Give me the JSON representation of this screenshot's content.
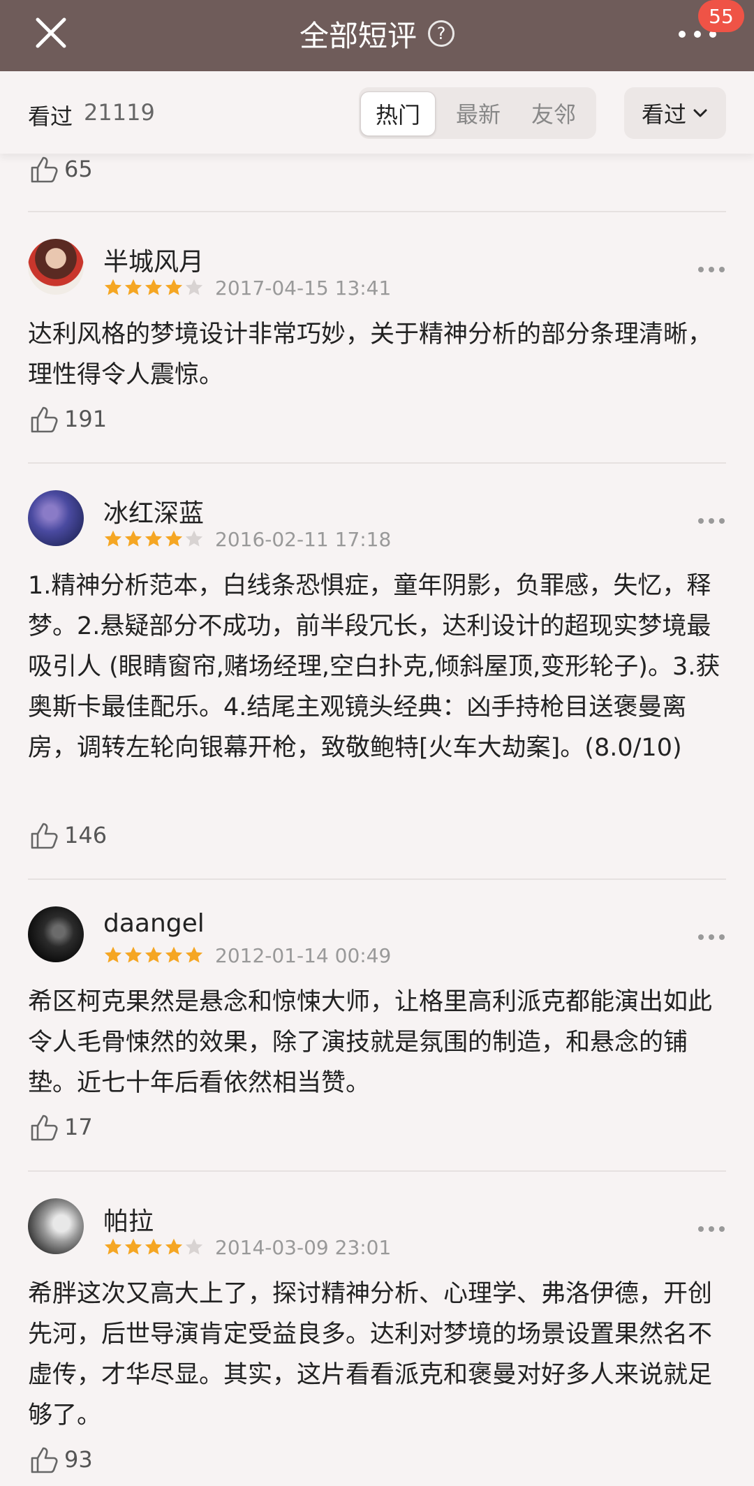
{
  "header": {
    "title": "全部短评",
    "badge_count": "55"
  },
  "filter": {
    "watched_label": "看过",
    "watched_count": "21119",
    "tabs": [
      "热门",
      "最新",
      "友邻"
    ],
    "active_tab": "热门",
    "dropdown_label": "看过"
  },
  "colors": {
    "header_bg": "#6f5c5a",
    "star": "#f5a623",
    "badge": "#ef5346"
  },
  "prev_likes": "65",
  "reviews": [
    {
      "user": "半城风月",
      "rating": 4,
      "date": "2017-04-15 13:41",
      "content": "达利风格的梦境设计非常巧妙，关于精神分析的部分条理清晰，理性得令人震惊。",
      "likes": "191"
    },
    {
      "user": "冰红深蓝",
      "rating": 4,
      "date": "2016-02-11 17:18",
      "content": "1.精神分析范本，白线条恐惧症，童年阴影，负罪感，失忆，释梦。2.悬疑部分不成功，前半段冗长，达利设计的超现实梦境最吸引人 (眼睛窗帘,赌场经理,空白扑克,倾斜屋顶,变形轮子)。3.获奥斯卡最佳配乐。4.结尾主观镜头经典：凶手持枪目送褒曼离房，调转左轮向银幕开枪，致敬鲍特[火车大劫案]。(8.0/10)",
      "likes": "146"
    },
    {
      "user": "daangel",
      "rating": 5,
      "date": "2012-01-14 00:49",
      "content": "希区柯克果然是悬念和惊悚大师，让格里高利派克都能演出如此令人毛骨悚然的效果，除了演技就是氛围的制造，和悬念的铺垫。近七十年后看依然相当赞。",
      "likes": "17"
    },
    {
      "user": "帕拉",
      "rating": 4,
      "date": "2014-03-09 23:01",
      "content": "希胖这次又高大上了，探讨精神分析、心理学、弗洛伊德，开创先河，后世导演肯定受益良多。达利对梦境的场景设置果然名不虚传，才华尽显。其实，这片看看派克和褒曼对好多人来说就足够了。",
      "likes": "93"
    }
  ]
}
